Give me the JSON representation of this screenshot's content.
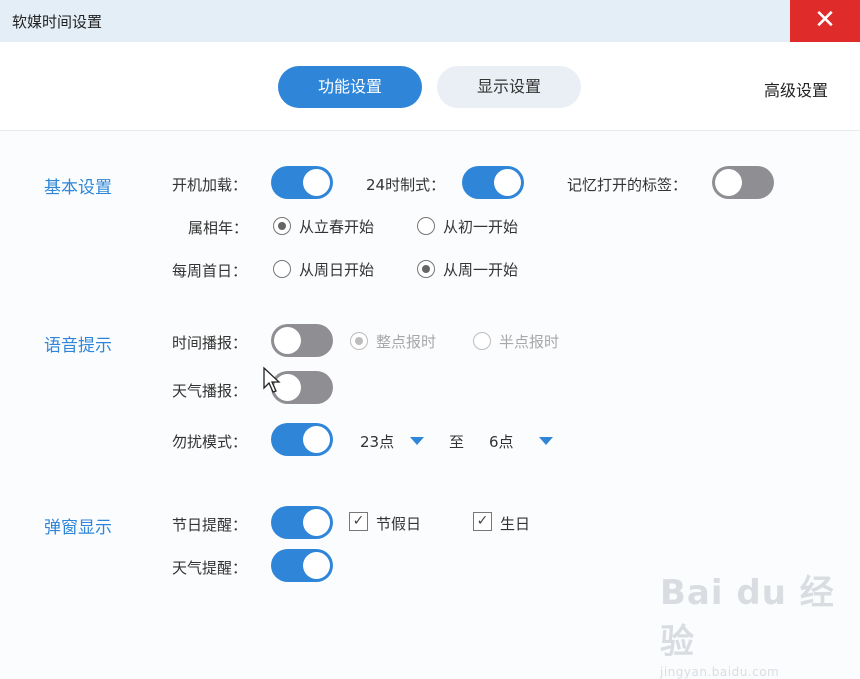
{
  "window": {
    "title": "软媒时间设置",
    "close_icon": "✕"
  },
  "tabs": [
    {
      "label": "功能设置",
      "active": true
    },
    {
      "label": "显示设置",
      "active": false
    },
    {
      "label": "高级设置",
      "active": false
    }
  ],
  "basic": {
    "title": "基本设置",
    "startup_label": "开机加载：",
    "startup_on": true,
    "clock24_label": "24时制式：",
    "clock24_on": true,
    "remember_tabs_label": "记忆打开的标签：",
    "remember_tabs_on": false,
    "zodiac_label": "属相年：",
    "zodiac_options": [
      "从立春开始",
      "从初一开始"
    ],
    "zodiac_selected": 0,
    "week_start_label": "每周首日：",
    "week_start_options": [
      "从周日开始",
      "从周一开始"
    ],
    "week_start_selected": 1
  },
  "voice": {
    "title": "语音提示",
    "time_report_label": "时间播报：",
    "time_report_on": false,
    "time_report_options": [
      "整点报时",
      "半点报时"
    ],
    "time_report_selected": 0,
    "weather_report_label": "天气播报：",
    "weather_report_on": false,
    "dnd_label": "勿扰模式：",
    "dnd_on": true,
    "dnd_from": "23点",
    "dnd_to_label": "至",
    "dnd_to": "6点"
  },
  "popup": {
    "title": "弹窗显示",
    "holiday_label": "节日提醒：",
    "holiday_on": true,
    "holiday_checks": [
      {
        "label": "节假日",
        "checked": true
      },
      {
        "label": "生日",
        "checked": true
      }
    ],
    "check_mark": "✓",
    "weather_label": "天气提醒：",
    "weather_on": true
  },
  "watermark": {
    "main": "Bai du 经验",
    "sub": "jingyan.baidu.com"
  },
  "colors": {
    "accent": "#2f86d8",
    "close_red": "#e02b2b",
    "toggle_off": "#8f8f93"
  }
}
